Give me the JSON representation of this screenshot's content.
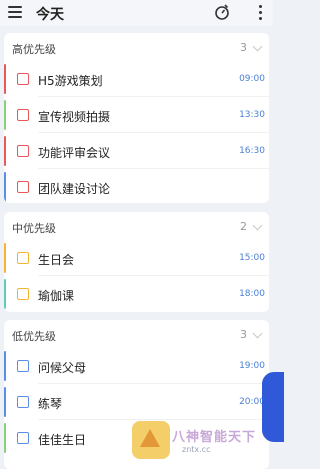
{
  "header": {
    "title": "今天"
  },
  "groups": [
    {
      "title": "高优先级",
      "count": "3",
      "items": [
        {
          "label": "H5游戏策划",
          "time": "09:00",
          "bar": "#e7585a",
          "check": "#e7585a"
        },
        {
          "label": "宣传视频拍摄",
          "time": "13:30",
          "bar": "#8bcf7c",
          "check": "#e7585a"
        },
        {
          "label": "功能评审会议",
          "time": "16:30",
          "bar": "#e7585a",
          "check": "#e7585a"
        },
        {
          "label": "团队建设讨论",
          "time": "",
          "bar": "#5b8ee6",
          "check": "#e7585a"
        }
      ]
    },
    {
      "title": "中优先级",
      "count": "2",
      "items": [
        {
          "label": "生日会",
          "time": "15:00",
          "bar": "#f5b33a",
          "check": "#f5b33a"
        },
        {
          "label": "瑜伽课",
          "time": "18:00",
          "bar": "#5ecbb8",
          "check": "#f5b33a"
        }
      ]
    },
    {
      "title": "低优先级",
      "count": "3",
      "items": [
        {
          "label": "问候父母",
          "time": "19:00",
          "bar": "#5b8ee6",
          "check": "#5b8ee6"
        },
        {
          "label": "练琴",
          "time": "20:00",
          "bar": "#5b8ee6",
          "check": "#5b8ee6"
        },
        {
          "label": "佳佳生日",
          "time": "",
          "bar": "#8bcf7c",
          "check": "#5b8ee6"
        }
      ]
    }
  ],
  "watermark": {
    "text": "八神智能天下",
    "url": "zntx.cc"
  },
  "icons": [
    "menu-icon",
    "timer-icon",
    "more-icon",
    "chevron-down-icon",
    "bell-icon"
  ]
}
